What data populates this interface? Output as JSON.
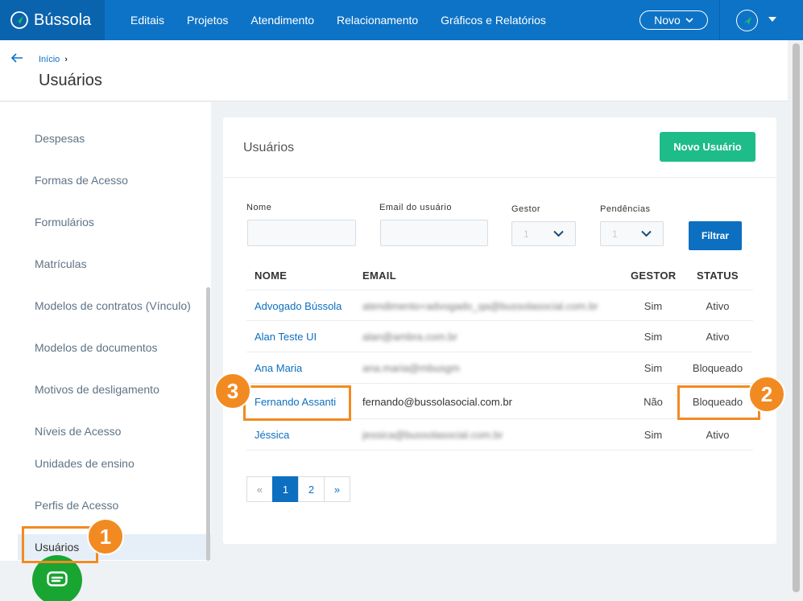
{
  "brand": {
    "name": "Bússola"
  },
  "nav": {
    "items": [
      "Editais",
      "Projetos",
      "Atendimento",
      "Relacionamento",
      "Gráficos e Relatórios"
    ]
  },
  "topbar": {
    "novo_label": "Novo"
  },
  "breadcrumb": {
    "home": "Início",
    "separator": "›"
  },
  "page": {
    "title": "Usuários"
  },
  "sidebar": {
    "items": [
      "Despesas",
      "Formas de Acesso",
      "Formulários",
      "Matrículas",
      "Modelos de contratos (Vínculo)",
      "Modelos de documentos",
      "Motivos de desligamento",
      "Níveis de Acesso",
      "Unidades de ensino",
      "Perfis de Acesso",
      "Usuários"
    ],
    "active": "Usuários"
  },
  "card": {
    "title": "Usuários",
    "new_button": "Novo Usuário"
  },
  "filters": {
    "nome_label": "Nome",
    "email_label": "Email do usuário",
    "gestor_label": "Gestor",
    "gestor_value": "1",
    "pendencias_label": "Pendências",
    "pendencias_value": "1",
    "submit": "Filtrar"
  },
  "table": {
    "headers": [
      "NOME",
      "EMAIL",
      "GESTOR",
      "STATUS"
    ],
    "rows": [
      {
        "name": "Advogado Bússola",
        "email": "atendimento+advogado_qa@bussolasocial.com.br",
        "gestor": "Sim",
        "status": "Ativo"
      },
      {
        "name": "Alan Teste UI",
        "email": "alan@ambra.com.br",
        "gestor": "Sim",
        "status": "Ativo"
      },
      {
        "name": "Ana Maria",
        "email": "ana.maria@mbusgm",
        "gestor": "Sim",
        "status": "Bloqueado"
      },
      {
        "name": "Fernando Assanti",
        "email": "fernando@bussolasocial.com.br",
        "gestor": "Não",
        "status": "Bloqueado"
      },
      {
        "name": "Jéssica",
        "email": "jessica@bussolasocial.com.br",
        "gestor": "Sim",
        "status": "Ativo"
      }
    ]
  },
  "pagination": {
    "prev": "«",
    "pages": [
      "1",
      "2"
    ],
    "next": "»",
    "current": "1"
  },
  "annotations": {
    "badge1": "1",
    "badge2": "2",
    "badge3": "3",
    "color": "#f28a22"
  }
}
